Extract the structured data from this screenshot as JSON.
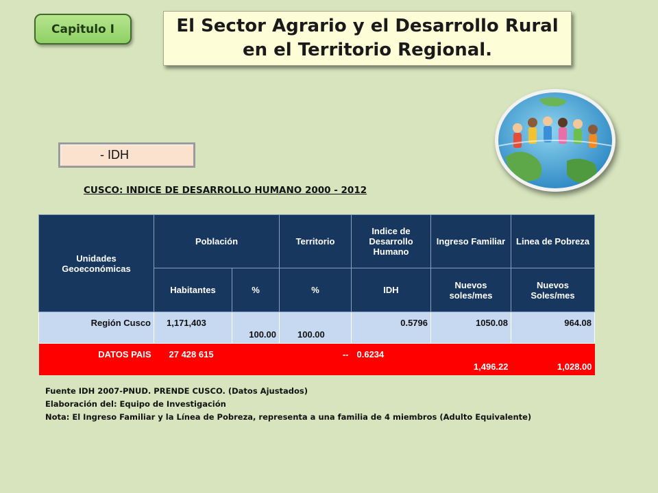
{
  "header": {
    "chapter_label": "Capitulo I",
    "title": "El Sector Agrario y el Desarrollo Rural en el Territorio Regional."
  },
  "section_label": "- IDH",
  "table": {
    "title": "CUSCO: INDICE DE DESARROLLO HUMANO 2000 - 2012",
    "headers": {
      "unidades": "Unidades Geoeconómicas",
      "poblacion": "Población",
      "territorio": "Territorio",
      "idh": "Indice de Desarrollo Humano",
      "ingreso": "Ingreso Familiar",
      "linea": "Linea de Pobreza"
    },
    "subheaders": {
      "habitantes": "Habitantes",
      "pct_poblacion": "%",
      "pct_territorio": "%",
      "idh": "IDH",
      "ingreso_unit": "Nuevos soles/mes",
      "linea_unit": "Nuevos Soles/mes"
    },
    "rows": [
      {
        "unidad": "Región Cusco",
        "habitantes": "1,171,403",
        "pct_poblacion": "100.00",
        "pct_territorio": "100.00",
        "idh": "0.5796",
        "ingreso": "1050.08",
        "linea": "964.08"
      },
      {
        "unidad": "DATOS PAIS",
        "habitantes": "27 428 615",
        "pct_territorio": "--",
        "idh": "0.6234",
        "ingreso": "1,496.22",
        "linea": "1,028.00"
      }
    ]
  },
  "footer": {
    "source": "Fuente IDH 2007-PNUD. PRENDE CUSCO. (Datos Ajustados)",
    "elaboration": "Elaboración del: Equipo de Investigación",
    "note": "Nota: El Ingreso Familiar y la Línea de Pobreza, representa a una familia de 4 miembros (Adulto Equivalente)"
  },
  "colors": {
    "background": "#d7e4bd",
    "table_header": "#17375e",
    "row_cusco": "#c6d9f1",
    "row_pais": "#ff0000"
  }
}
